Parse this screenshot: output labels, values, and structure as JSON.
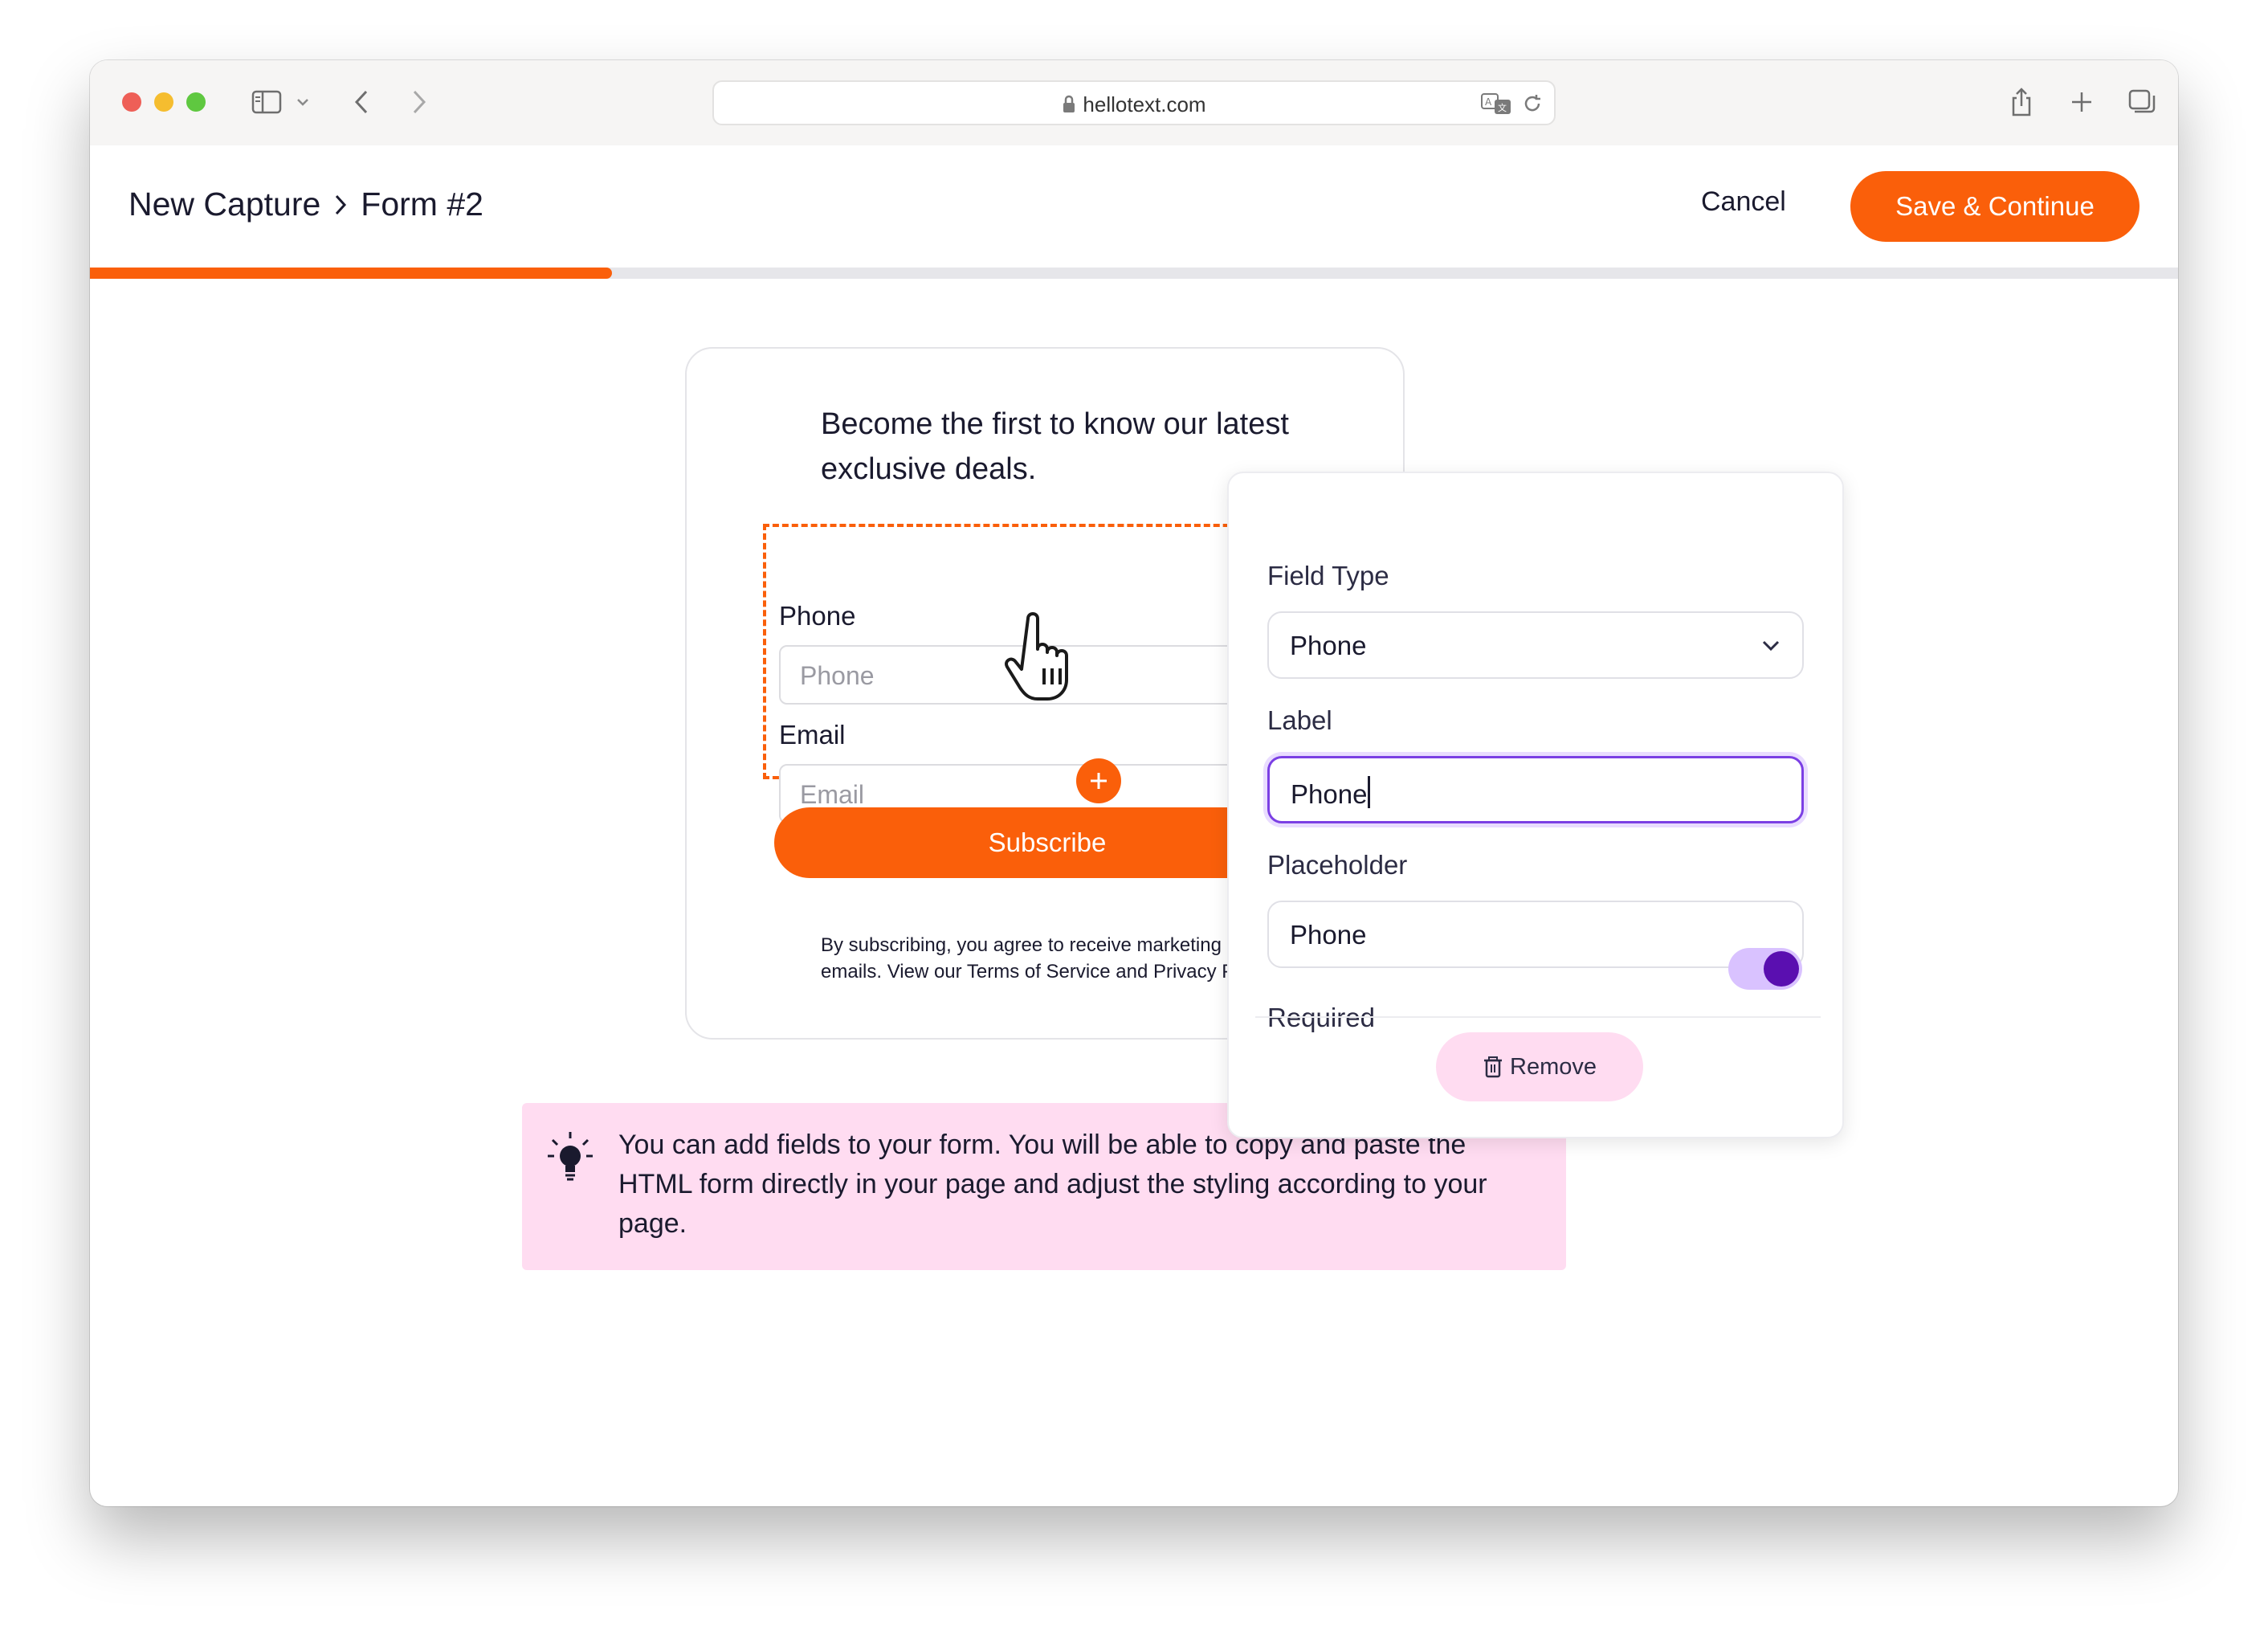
{
  "browser": {
    "url": "hellotext.com"
  },
  "header": {
    "breadcrumb": [
      "New Capture",
      "Form #2"
    ],
    "cancel_label": "Cancel",
    "save_label": "Save & Continue",
    "progress_fraction": 0.25
  },
  "form": {
    "heading": "Become the first to know our latest exclusive deals.",
    "fields": [
      {
        "label": "Phone",
        "placeholder": "Phone"
      },
      {
        "label": "Email",
        "placeholder": "Email"
      }
    ],
    "subscribe_label": "Subscribe",
    "disclaimer_line1": "By subscribing, you agree to receive marketing",
    "disclaimer_line2": "emails. View our Terms of Service and Privacy P"
  },
  "tip": {
    "text": "You can add fields to your form. You will be able to copy and paste the HTML form directly in your page and adjust the styling according to your page."
  },
  "panel": {
    "field_type_label": "Field Type",
    "field_type_value": "Phone",
    "label_label": "Label",
    "label_value": "Phone",
    "placeholder_label": "Placeholder",
    "placeholder_value": "Phone",
    "required_label": "Required",
    "required_on": true,
    "remove_label": "Remove"
  },
  "colors": {
    "accent": "#fa5f0a",
    "focus": "#7b3fe4",
    "toggle_on": "#5a0fb0",
    "tip_bg": "#ffdcf1"
  }
}
